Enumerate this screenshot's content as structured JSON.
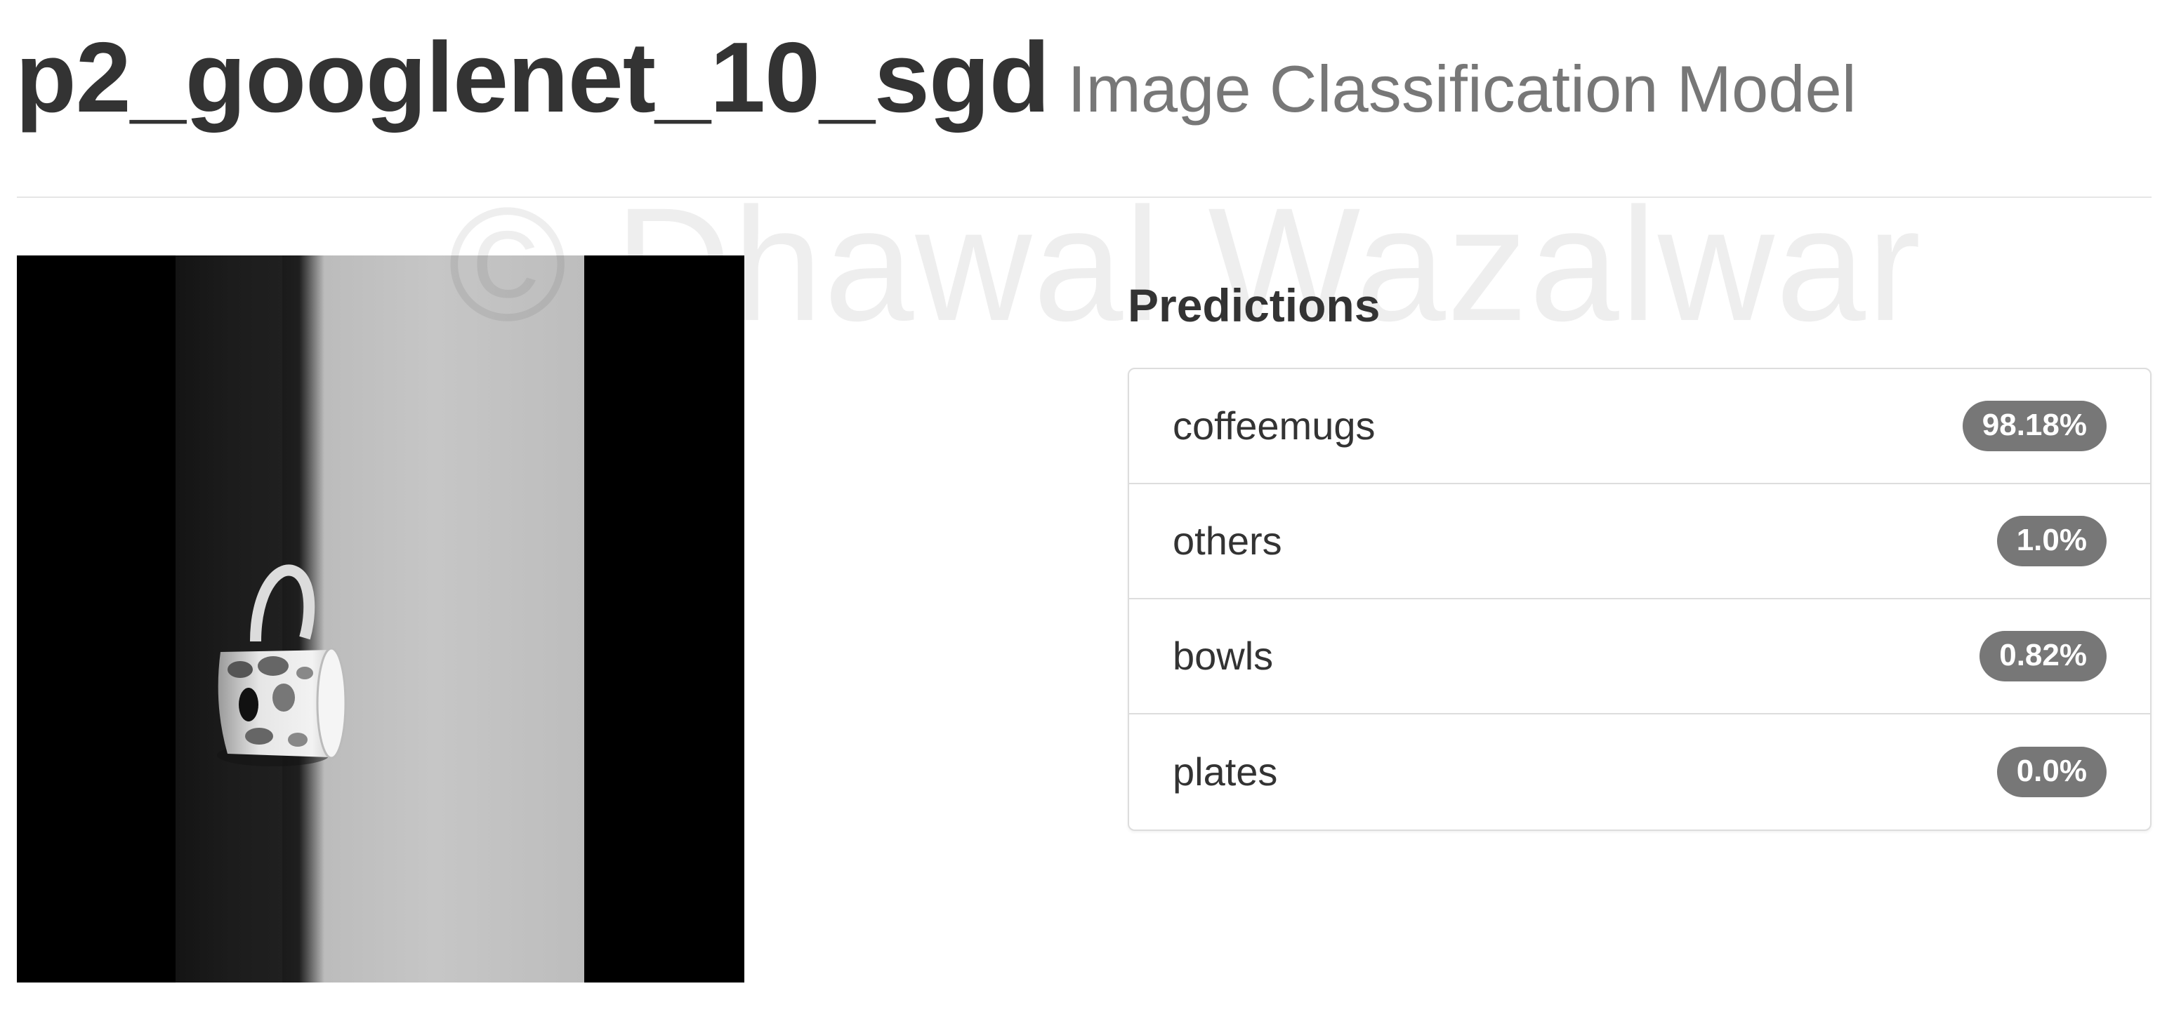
{
  "header": {
    "model_name": "p2_googlenet_10_sgd",
    "subtitle": "Image Classification Model"
  },
  "watermark": "© Dhawal Wazalwar",
  "image": {
    "description_icon": "coffee-mug-photo"
  },
  "predictions": {
    "heading": "Predictions",
    "items": [
      {
        "label": "coffeemugs",
        "value": "98.18%"
      },
      {
        "label": "others",
        "value": "1.0%"
      },
      {
        "label": "bowls",
        "value": "0.82%"
      },
      {
        "label": "plates",
        "value": "0.0%"
      }
    ]
  },
  "colors": {
    "badge": "#777777",
    "text": "#333333",
    "subtitle": "#777777",
    "border": "#dddddd"
  }
}
